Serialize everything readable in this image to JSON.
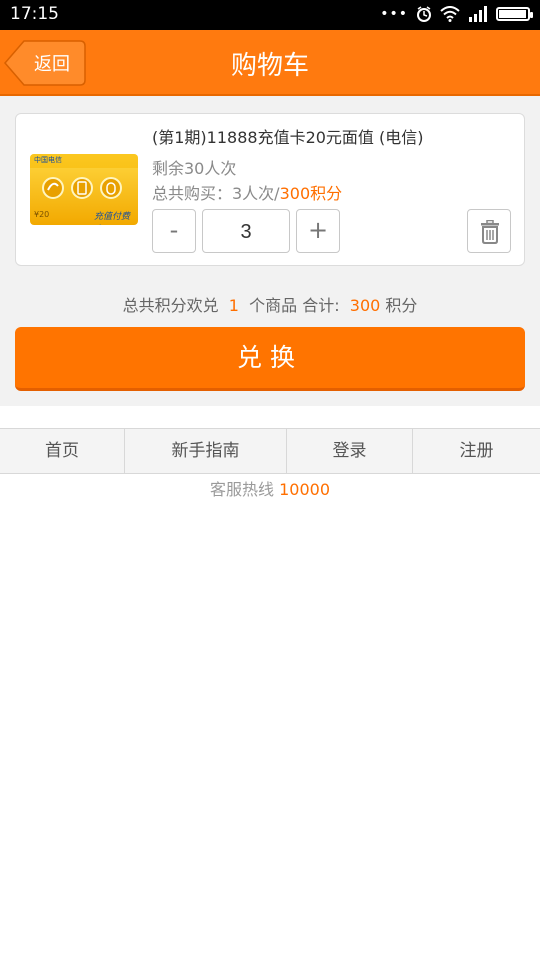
{
  "statusbar": {
    "time": "17:15",
    "icons": [
      "more-dots-icon",
      "alarm-icon",
      "wifi-icon",
      "signal-icon",
      "battery-icon"
    ]
  },
  "header": {
    "back_label": "返回",
    "title": "购物车"
  },
  "cart": {
    "item": {
      "title": "(第1期)11888充值卡20元面值 (电信)",
      "remaining": "剩余30人次",
      "bought_prefix": "总共购买：3人次/",
      "bought_points": "300积分",
      "quantity": "3",
      "minus_label": "-",
      "plus_label": "+",
      "thumb": {
        "card_value": "¥20",
        "card_brand": "充值付费卡",
        "carrier": "中国电信"
      }
    },
    "summary": {
      "prefix": "总共积分欢兑",
      "count": "1",
      "middle": "个商品 合计:",
      "points": "300",
      "suffix": "积分"
    },
    "exchange_label": "兑换"
  },
  "footer": {
    "tabs": [
      "首页",
      "新手指南",
      "登录",
      "注册"
    ],
    "hotline_label": "客服热线",
    "hotline_number": "10000"
  },
  "colors": {
    "accent": "#ff7a0f",
    "price": "#ff6f00"
  }
}
